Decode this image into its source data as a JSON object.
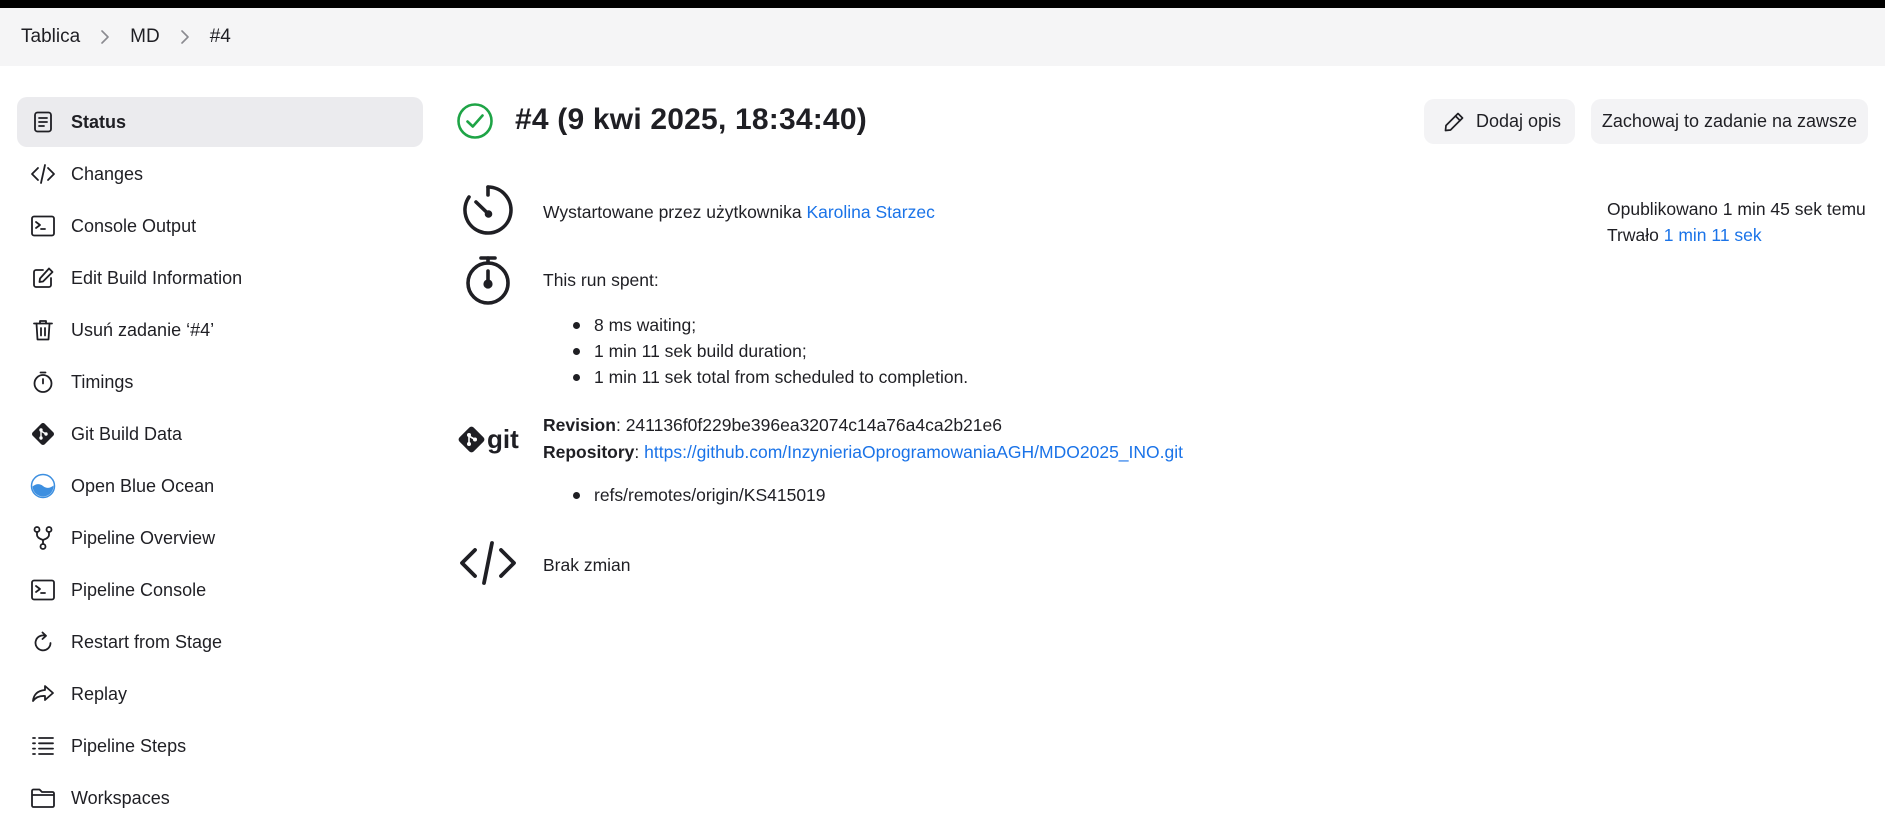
{
  "breadcrumb": {
    "items": [
      "Tablica",
      "MD",
      "#4"
    ]
  },
  "sidebar": {
    "items": [
      {
        "label": "Status",
        "icon": "document-icon",
        "active": true
      },
      {
        "label": "Changes",
        "icon": "code-icon"
      },
      {
        "label": "Console Output",
        "icon": "terminal-icon"
      },
      {
        "label": "Edit Build Information",
        "icon": "edit-icon"
      },
      {
        "label": "Usuń zadanie ‘#4’",
        "icon": "trash-icon"
      },
      {
        "label": "Timings",
        "icon": "stopwatch-icon"
      },
      {
        "label": "Git Build Data",
        "icon": "git-icon"
      },
      {
        "label": "Open Blue Ocean",
        "icon": "blue-ocean-icon"
      },
      {
        "label": "Pipeline Overview",
        "icon": "branch-icon"
      },
      {
        "label": "Pipeline Console",
        "icon": "terminal-icon"
      },
      {
        "label": "Restart from Stage",
        "icon": "restart-icon"
      },
      {
        "label": "Replay",
        "icon": "replay-icon"
      },
      {
        "label": "Pipeline Steps",
        "icon": "list-icon"
      },
      {
        "label": "Workspaces",
        "icon": "folder-icon"
      }
    ]
  },
  "header": {
    "title": "#4 (9 kwi 2025, 18:34:40)",
    "status_icon": "success-check-icon",
    "status_color": "#1ea446",
    "add_description_label": "Dodaj opis",
    "keep_forever_label": "Zachowaj to zadanie na zawsze"
  },
  "started": {
    "prefix": "Wystartowane przez użytkownika",
    "user": "Karolina Starzec"
  },
  "timings": {
    "intro": "This run spent:",
    "items": [
      "8 ms waiting;",
      "1 min 11 sek build duration;",
      "1 min 11 sek total from scheduled to completion."
    ]
  },
  "git": {
    "logo_text": "git",
    "revision_label": "Revision",
    "revision": "241136f0f229be396ea32074c14a76a4ca2b21e6",
    "repository_label": "Repository",
    "repository": "https://github.com/InzynieriaOprogramowaniaAGH/MDO2025_INO.git",
    "refs": [
      "refs/remotes/origin/KS415019"
    ]
  },
  "changes": {
    "text": "Brak zmian"
  },
  "meta": {
    "published": "Opublikowano 1 min 45 sek temu",
    "duration_prefix": "Trwało",
    "duration": "1 min 11 sek"
  },
  "colors": {
    "link": "#1a73e8",
    "success": "#1ea446",
    "active_bg": "#ebebee"
  }
}
